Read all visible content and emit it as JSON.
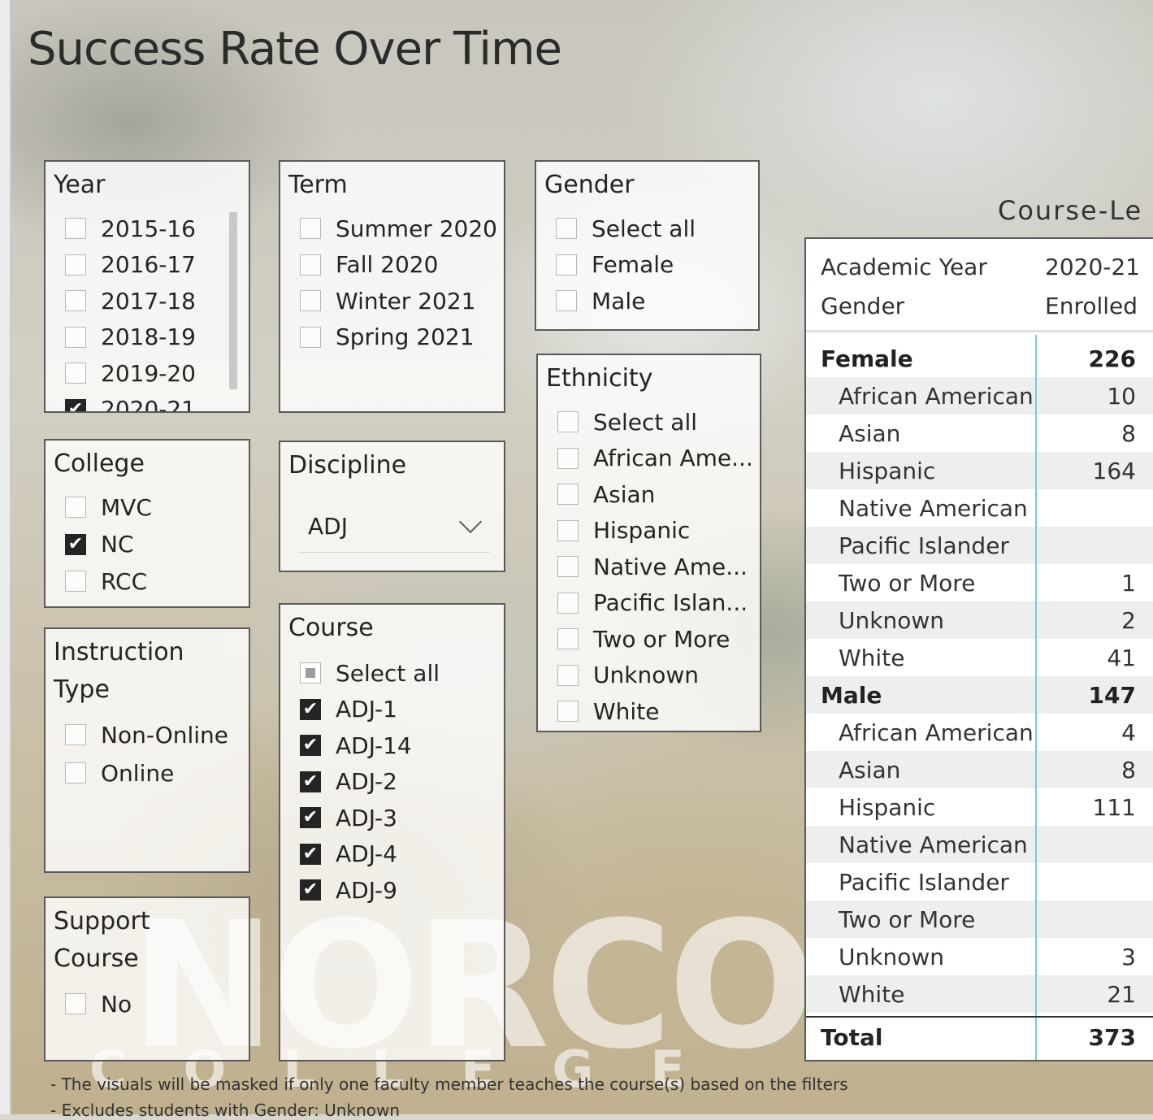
{
  "page": {
    "title": "Success Rate Over Time",
    "watermark": "NORCO",
    "watermark_sub": "COLLEGE",
    "footnotes": [
      "- The visuals will be masked if only one faculty member teaches the course(s) based on the filters",
      "- Excludes students with Gender: Unknown"
    ]
  },
  "filters": {
    "year": {
      "title": "Year",
      "options": [
        {
          "label": "2015-16",
          "checked": false
        },
        {
          "label": "2016-17",
          "checked": false
        },
        {
          "label": "2017-18",
          "checked": false
        },
        {
          "label": "2018-19",
          "checked": false
        },
        {
          "label": "2019-20",
          "checked": false
        },
        {
          "label": "2020-21",
          "checked": true
        }
      ]
    },
    "term": {
      "title": "Term",
      "options": [
        {
          "label": "Summer 2020",
          "checked": false
        },
        {
          "label": "Fall 2020",
          "checked": false
        },
        {
          "label": "Winter 2021",
          "checked": false
        },
        {
          "label": "Spring 2021",
          "checked": false
        }
      ]
    },
    "gender": {
      "title": "Gender",
      "options": [
        {
          "label": "Select all",
          "checked": false
        },
        {
          "label": "Female",
          "checked": false
        },
        {
          "label": "Male",
          "checked": false
        }
      ]
    },
    "ethnicity": {
      "title": "Ethnicity",
      "options": [
        {
          "label": "Select all",
          "checked": false
        },
        {
          "label": "African Ame...",
          "checked": false
        },
        {
          "label": "Asian",
          "checked": false
        },
        {
          "label": "Hispanic",
          "checked": false
        },
        {
          "label": "Native Ame...",
          "checked": false
        },
        {
          "label": "Pacific Islan...",
          "checked": false
        },
        {
          "label": "Two or More",
          "checked": false
        },
        {
          "label": "Unknown",
          "checked": false
        },
        {
          "label": "White",
          "checked": false
        }
      ]
    },
    "college": {
      "title": "College",
      "options": [
        {
          "label": "MVC",
          "checked": false
        },
        {
          "label": "NC",
          "checked": true
        },
        {
          "label": "RCC",
          "checked": false
        }
      ]
    },
    "discipline": {
      "title": "Discipline",
      "selected": "ADJ"
    },
    "instruction_type": {
      "title_line1": "Instruction",
      "title_line2": "Type",
      "options": [
        {
          "label": "Non-Online",
          "checked": false
        },
        {
          "label": "Online",
          "checked": false
        }
      ]
    },
    "course": {
      "title": "Course",
      "options": [
        {
          "label": "Select all",
          "checked": "partial"
        },
        {
          "label": "ADJ-1",
          "checked": true
        },
        {
          "label": "ADJ-14",
          "checked": true
        },
        {
          "label": "ADJ-2",
          "checked": true
        },
        {
          "label": "ADJ-3",
          "checked": true
        },
        {
          "label": "ADJ-4",
          "checked": true
        },
        {
          "label": "ADJ-9",
          "checked": true
        }
      ]
    },
    "support_course": {
      "title_line1": "Support",
      "title_line2": "Course",
      "options": [
        {
          "label": "No",
          "checked": false
        }
      ]
    }
  },
  "table": {
    "title": "Course-Le",
    "header": {
      "academic_year_label": "Academic Year",
      "academic_year_value": "2020-21",
      "gender_label": "Gender",
      "measure_label": "Enrolled"
    },
    "rows": [
      {
        "label": "Female",
        "value": "226",
        "group": true
      },
      {
        "label": "African American",
        "value": "10"
      },
      {
        "label": "Asian",
        "value": "8"
      },
      {
        "label": "Hispanic",
        "value": "164"
      },
      {
        "label": "Native American",
        "value": ""
      },
      {
        "label": "Pacific Islander",
        "value": ""
      },
      {
        "label": "Two or More",
        "value": "1"
      },
      {
        "label": "Unknown",
        "value": "2"
      },
      {
        "label": "White",
        "value": "41"
      },
      {
        "label": "Male",
        "value": "147",
        "group": true
      },
      {
        "label": "African American",
        "value": "4"
      },
      {
        "label": "Asian",
        "value": "8"
      },
      {
        "label": "Hispanic",
        "value": "111"
      },
      {
        "label": "Native American",
        "value": ""
      },
      {
        "label": "Pacific Islander",
        "value": ""
      },
      {
        "label": "Two or More",
        "value": ""
      },
      {
        "label": "Unknown",
        "value": "3"
      },
      {
        "label": "White",
        "value": "21"
      }
    ],
    "total": {
      "label": "Total",
      "value": "373"
    }
  }
}
